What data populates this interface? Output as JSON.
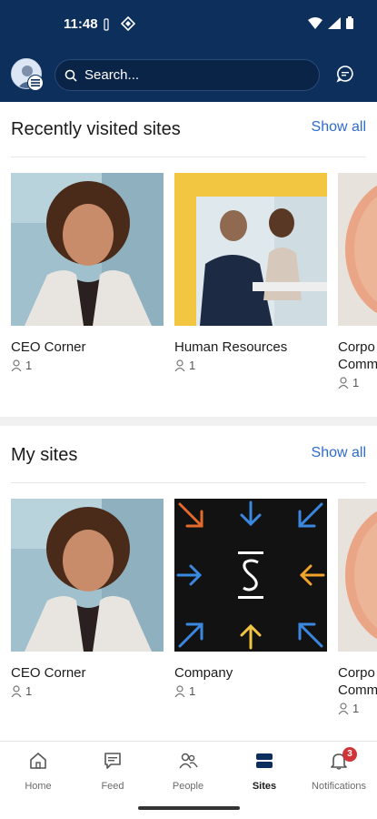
{
  "status": {
    "time": "11:48"
  },
  "search": {
    "placeholder": "Search..."
  },
  "recent": {
    "title": "Recently visited sites",
    "show_all": "Show all",
    "cards": [
      {
        "title": "CEO Corner",
        "members": "1"
      },
      {
        "title": "Human Resources",
        "members": "1"
      },
      {
        "title": "Corpo\nComm",
        "members": "1"
      }
    ]
  },
  "mysites": {
    "title": "My sites",
    "show_all": "Show all",
    "cards": [
      {
        "title": "CEO Corner",
        "members": "1"
      },
      {
        "title": "Company",
        "members": "1"
      },
      {
        "title": "Corpo\nComm",
        "members": "1"
      }
    ]
  },
  "nav": {
    "items": [
      {
        "label": "Home"
      },
      {
        "label": "Feed"
      },
      {
        "label": "People"
      },
      {
        "label": "Sites"
      },
      {
        "label": "Notifications"
      }
    ],
    "notifications_badge": "3"
  },
  "colors": {
    "header": "#0d2f5c",
    "link": "#2f6cc9",
    "badge": "#d13438"
  }
}
